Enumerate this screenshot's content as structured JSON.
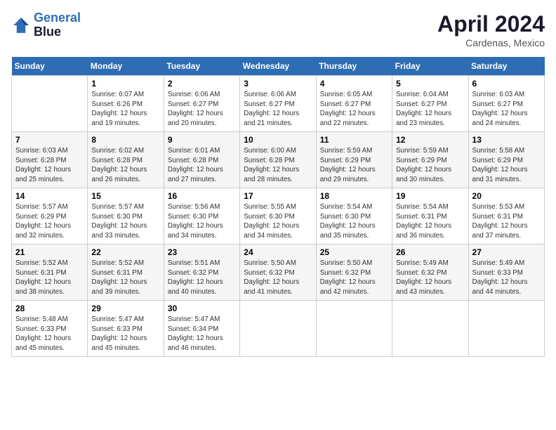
{
  "header": {
    "logo_line1": "General",
    "logo_line2": "Blue",
    "month_year": "April 2024",
    "location": "Cardenas, Mexico"
  },
  "weekdays": [
    "Sunday",
    "Monday",
    "Tuesday",
    "Wednesday",
    "Thursday",
    "Friday",
    "Saturday"
  ],
  "weeks": [
    [
      {
        "num": "",
        "info": ""
      },
      {
        "num": "1",
        "info": "Sunrise: 6:07 AM\nSunset: 6:26 PM\nDaylight: 12 hours\nand 19 minutes."
      },
      {
        "num": "2",
        "info": "Sunrise: 6:06 AM\nSunset: 6:27 PM\nDaylight: 12 hours\nand 20 minutes."
      },
      {
        "num": "3",
        "info": "Sunrise: 6:06 AM\nSunset: 6:27 PM\nDaylight: 12 hours\nand 21 minutes."
      },
      {
        "num": "4",
        "info": "Sunrise: 6:05 AM\nSunset: 6:27 PM\nDaylight: 12 hours\nand 22 minutes."
      },
      {
        "num": "5",
        "info": "Sunrise: 6:04 AM\nSunset: 6:27 PM\nDaylight: 12 hours\nand 23 minutes."
      },
      {
        "num": "6",
        "info": "Sunrise: 6:03 AM\nSunset: 6:27 PM\nDaylight: 12 hours\nand 24 minutes."
      }
    ],
    [
      {
        "num": "7",
        "info": "Sunrise: 6:03 AM\nSunset: 6:28 PM\nDaylight: 12 hours\nand 25 minutes."
      },
      {
        "num": "8",
        "info": "Sunrise: 6:02 AM\nSunset: 6:28 PM\nDaylight: 12 hours\nand 26 minutes."
      },
      {
        "num": "9",
        "info": "Sunrise: 6:01 AM\nSunset: 6:28 PM\nDaylight: 12 hours\nand 27 minutes."
      },
      {
        "num": "10",
        "info": "Sunrise: 6:00 AM\nSunset: 6:28 PM\nDaylight: 12 hours\nand 28 minutes."
      },
      {
        "num": "11",
        "info": "Sunrise: 5:59 AM\nSunset: 6:29 PM\nDaylight: 12 hours\nand 29 minutes."
      },
      {
        "num": "12",
        "info": "Sunrise: 5:59 AM\nSunset: 6:29 PM\nDaylight: 12 hours\nand 30 minutes."
      },
      {
        "num": "13",
        "info": "Sunrise: 5:58 AM\nSunset: 6:29 PM\nDaylight: 12 hours\nand 31 minutes."
      }
    ],
    [
      {
        "num": "14",
        "info": "Sunrise: 5:57 AM\nSunset: 6:29 PM\nDaylight: 12 hours\nand 32 minutes."
      },
      {
        "num": "15",
        "info": "Sunrise: 5:57 AM\nSunset: 6:30 PM\nDaylight: 12 hours\nand 33 minutes."
      },
      {
        "num": "16",
        "info": "Sunrise: 5:56 AM\nSunset: 6:30 PM\nDaylight: 12 hours\nand 34 minutes."
      },
      {
        "num": "17",
        "info": "Sunrise: 5:55 AM\nSunset: 6:30 PM\nDaylight: 12 hours\nand 34 minutes."
      },
      {
        "num": "18",
        "info": "Sunrise: 5:54 AM\nSunset: 6:30 PM\nDaylight: 12 hours\nand 35 minutes."
      },
      {
        "num": "19",
        "info": "Sunrise: 5:54 AM\nSunset: 6:31 PM\nDaylight: 12 hours\nand 36 minutes."
      },
      {
        "num": "20",
        "info": "Sunrise: 5:53 AM\nSunset: 6:31 PM\nDaylight: 12 hours\nand 37 minutes."
      }
    ],
    [
      {
        "num": "21",
        "info": "Sunrise: 5:52 AM\nSunset: 6:31 PM\nDaylight: 12 hours\nand 38 minutes."
      },
      {
        "num": "22",
        "info": "Sunrise: 5:52 AM\nSunset: 6:31 PM\nDaylight: 12 hours\nand 39 minutes."
      },
      {
        "num": "23",
        "info": "Sunrise: 5:51 AM\nSunset: 6:32 PM\nDaylight: 12 hours\nand 40 minutes."
      },
      {
        "num": "24",
        "info": "Sunrise: 5:50 AM\nSunset: 6:32 PM\nDaylight: 12 hours\nand 41 minutes."
      },
      {
        "num": "25",
        "info": "Sunrise: 5:50 AM\nSunset: 6:32 PM\nDaylight: 12 hours\nand 42 minutes."
      },
      {
        "num": "26",
        "info": "Sunrise: 5:49 AM\nSunset: 6:32 PM\nDaylight: 12 hours\nand 43 minutes."
      },
      {
        "num": "27",
        "info": "Sunrise: 5:49 AM\nSunset: 6:33 PM\nDaylight: 12 hours\nand 44 minutes."
      }
    ],
    [
      {
        "num": "28",
        "info": "Sunrise: 5:48 AM\nSunset: 6:33 PM\nDaylight: 12 hours\nand 45 minutes."
      },
      {
        "num": "29",
        "info": "Sunrise: 5:47 AM\nSunset: 6:33 PM\nDaylight: 12 hours\nand 45 minutes."
      },
      {
        "num": "30",
        "info": "Sunrise: 5:47 AM\nSunset: 6:34 PM\nDaylight: 12 hours\nand 46 minutes."
      },
      {
        "num": "",
        "info": ""
      },
      {
        "num": "",
        "info": ""
      },
      {
        "num": "",
        "info": ""
      },
      {
        "num": "",
        "info": ""
      }
    ]
  ]
}
